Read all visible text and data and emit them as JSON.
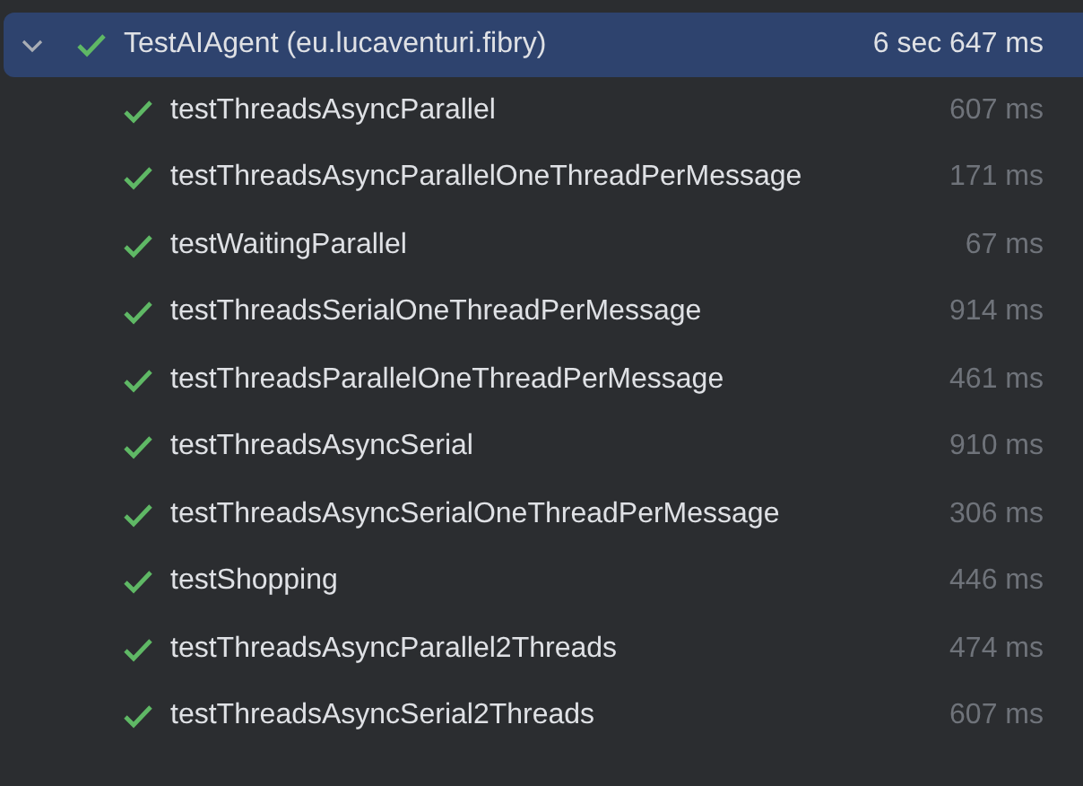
{
  "suite": {
    "name": "TestAIAgent (eu.lucaventuri.fibry)",
    "duration": "6 sec 647 ms",
    "passed": true,
    "expanded": true,
    "selected": true,
    "tests": [
      {
        "name": "testThreadsAsyncParallel",
        "duration": "607 ms",
        "passed": true,
        "selected": false
      },
      {
        "name": "testThreadsAsyncParallelOneThreadPerMessage",
        "duration": "171 ms",
        "passed": true,
        "selected": false
      },
      {
        "name": "testWaitingParallel",
        "duration": "67 ms",
        "passed": true,
        "selected": false
      },
      {
        "name": "testThreadsSerialOneThreadPerMessage",
        "duration": "914 ms",
        "passed": true,
        "selected": false
      },
      {
        "name": "testThreadsParallelOneThreadPerMessage",
        "duration": "461 ms",
        "passed": true,
        "selected": false
      },
      {
        "name": "testThreadsAsyncSerial",
        "duration": "910 ms",
        "passed": true,
        "selected": false
      },
      {
        "name": "testThreadsAsyncSerialOneThreadPerMessage",
        "duration": "306 ms",
        "passed": true,
        "selected": false
      },
      {
        "name": "testShopping",
        "duration": "446 ms",
        "passed": true,
        "selected": false
      },
      {
        "name": "testThreadsAsyncParallel2Threads",
        "duration": "474 ms",
        "passed": true,
        "selected": false
      },
      {
        "name": "testThreadsAsyncSerial2Threads",
        "duration": "607 ms",
        "passed": true,
        "selected": false
      }
    ]
  }
}
